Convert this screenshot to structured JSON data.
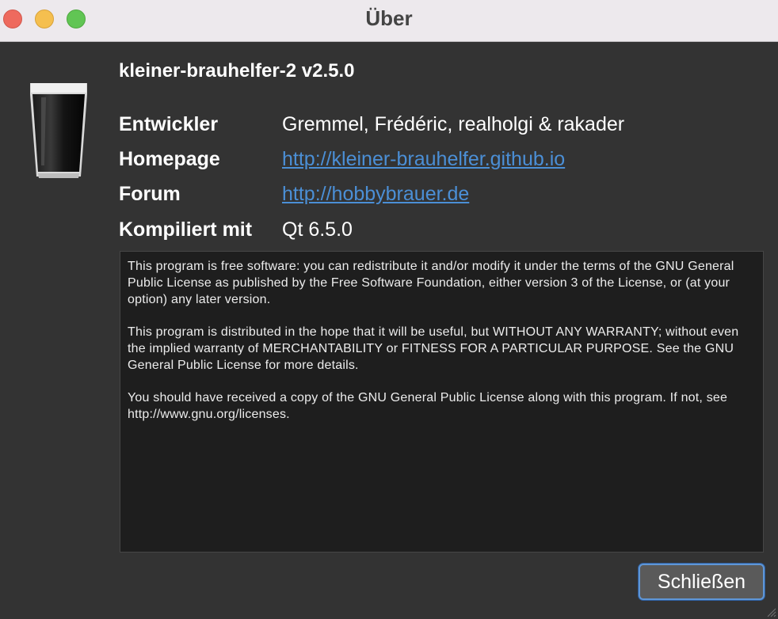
{
  "window": {
    "title": "Über"
  },
  "app": {
    "name": "kleiner-brauhelfer-2 v2.5.0"
  },
  "info": [
    {
      "label": "Entwickler",
      "value": "Gremmel, Frédéric, realholgi & rakader"
    },
    {
      "label": "Homepage",
      "value": "http://kleiner-brauhelfer.github.io"
    },
    {
      "label": "Forum",
      "value": "http://hobbybrauer.de"
    },
    {
      "label": "Kompiliert mit",
      "value": "Qt 6.5.0"
    }
  ],
  "license": {
    "paragraphs": [
      "This program is free software: you can redistribute it and/or modify it under the terms of the GNU General Public License as published by the Free Software Foundation, either version 3 of the License, or (at your option) any later version.",
      "This program is distributed in the hope that it will be useful, but WITHOUT ANY WARRANTY; without even the implied warranty of MERCHANTABILITY or FITNESS FOR A PARTICULAR PURPOSE. See the GNU General Public License for more details.",
      "You should have received a copy of the GNU General Public License along with this program. If not, see http://www.gnu.org/licenses."
    ]
  },
  "buttons": {
    "close_label": "Schließen"
  },
  "colors": {
    "link": "#4b8fd6",
    "accent": "#5f96d6",
    "background": "#333333"
  }
}
